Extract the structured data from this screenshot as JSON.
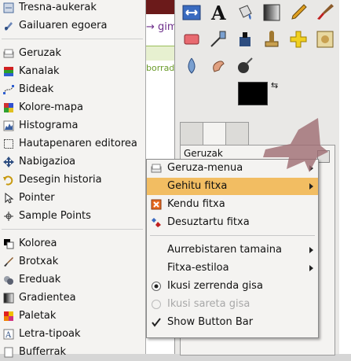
{
  "left_menu": {
    "items": [
      {
        "label": "Tresna-aukerak",
        "icon": "tool-options-icon"
      },
      {
        "label": "Gailuaren egoera",
        "icon": "device-status-icon"
      },
      {
        "label": "Geruzak",
        "icon": "layers-icon"
      },
      {
        "label": "Kanalak",
        "icon": "channels-icon"
      },
      {
        "label": "Bideak",
        "icon": "paths-icon"
      },
      {
        "label": "Kolore-mapa",
        "icon": "colormap-icon"
      },
      {
        "label": "Histograma",
        "icon": "histogram-icon"
      },
      {
        "label": "Hautapenaren editorea",
        "icon": "selection-editor-icon"
      },
      {
        "label": "Nabigazioa",
        "icon": "navigation-icon"
      },
      {
        "label": "Desegin historia",
        "icon": "undo-history-icon"
      },
      {
        "label": "Pointer",
        "icon": "pointer-icon"
      },
      {
        "label": "Sample Points",
        "icon": "sample-points-icon"
      },
      {
        "label": "Kolorea",
        "icon": "colors-icon"
      },
      {
        "label": "Brotxak",
        "icon": "brushes-icon"
      },
      {
        "label": "Ereduak",
        "icon": "patterns-icon"
      },
      {
        "label": "Gradientea",
        "icon": "gradients-icon"
      },
      {
        "label": "Paletak",
        "icon": "palettes-icon"
      },
      {
        "label": "Letra-tipoak",
        "icon": "fonts-icon"
      },
      {
        "label": "Bufferrak",
        "icon": "buffers-icon"
      }
    ]
  },
  "browser": {
    "url_fragment": "→ gim",
    "tab_fragment": "borrado"
  },
  "dock": {
    "title": "Geruzak",
    "combo_value": "0"
  },
  "popup_menu": {
    "items": [
      {
        "label": "Geruza-menua",
        "icon": "layers-menu-icon",
        "submenu": true
      },
      {
        "label": "Gehitu fitxa",
        "submenu": true,
        "highlighted": true
      },
      {
        "label": "Kendu fitxa",
        "icon": "close-tab-icon"
      },
      {
        "label": "Desuztartu fitxa",
        "icon": "detach-tab-icon"
      },
      {
        "label": "Aurrebistaren tamaina",
        "submenu": true
      },
      {
        "label": "Fitxa-estiloa",
        "submenu": true
      },
      {
        "label": "Ikusi zerrenda gisa",
        "radio": true,
        "checked": true
      },
      {
        "label": "Ikusi sareta gisa",
        "radio": true,
        "checked": false,
        "disabled": true
      },
      {
        "label": "Show Button Bar",
        "check": true,
        "checked": true
      }
    ]
  },
  "colors": {
    "highlight": "#f2bd62",
    "menu_bg": "#f4f3f1",
    "arrow_annotation": "#9e6b72"
  }
}
